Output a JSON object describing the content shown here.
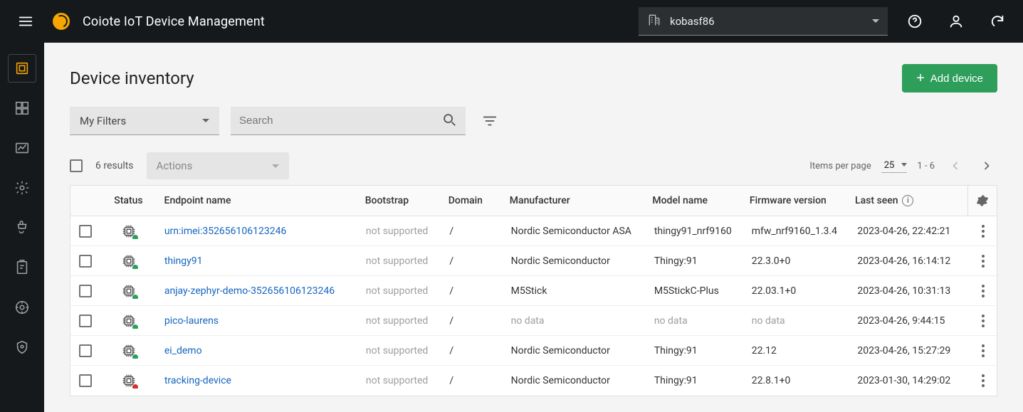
{
  "app_title": "Coiote IoT Device Management",
  "tenant_name": "kobasf86",
  "page_title": "Device inventory",
  "add_button": "Add device",
  "filters_dropdown": "My Filters",
  "search_placeholder": "Search",
  "results_label": "6 results",
  "actions_label": "Actions",
  "items_per_page_label": "Items per page",
  "items_per_page_value": "25",
  "page_range": "1 - 6",
  "columns": {
    "status": "Status",
    "endpoint": "Endpoint name",
    "bootstrap": "Bootstrap",
    "domain": "Domain",
    "manufacturer": "Manufacturer",
    "model": "Model name",
    "firmware": "Firmware version",
    "last_seen": "Last seen"
  },
  "rows": [
    {
      "status": "online",
      "endpoint": "urn:imei:352656106123246",
      "bootstrap": "not supported",
      "domain": "/",
      "manufacturer": "Nordic Semiconductor ASA",
      "model": "thingy91_nrf9160",
      "firmware": "mfw_nrf9160_1.3.4",
      "last_seen": "2023-04-26, 22:42:21"
    },
    {
      "status": "online",
      "endpoint": "thingy91",
      "bootstrap": "not supported",
      "domain": "/",
      "manufacturer": "Nordic Semiconductor",
      "model": "Thingy:91",
      "firmware": "22.3.0+0",
      "last_seen": "2023-04-26, 16:14:12"
    },
    {
      "status": "online",
      "endpoint": "anjay-zephyr-demo-352656106123246",
      "bootstrap": "not supported",
      "domain": "/",
      "manufacturer": "M5Stick",
      "model": "M5StickC-Plus",
      "firmware": "22.03.1+0",
      "last_seen": "2023-04-26, 10:31:13"
    },
    {
      "status": "online",
      "endpoint": "pico-laurens",
      "bootstrap": "not supported",
      "domain": "/",
      "manufacturer": "no data",
      "manufacturer_muted": true,
      "model": "no data",
      "model_muted": true,
      "firmware": "no data",
      "firmware_muted": true,
      "last_seen": "2023-04-26, 9:44:15"
    },
    {
      "status": "online",
      "endpoint": "ei_demo",
      "bootstrap": "not supported",
      "domain": "/",
      "manufacturer": "Nordic Semiconductor",
      "model": "Thingy:91",
      "firmware": "22.12",
      "last_seen": "2023-04-26, 15:27:29"
    },
    {
      "status": "offline",
      "endpoint": "tracking-device",
      "bootstrap": "not supported",
      "domain": "/",
      "manufacturer": "Nordic Semiconductor",
      "model": "Thingy:91",
      "firmware": "22.8.1+0",
      "last_seen": "2023-01-30, 14:29:02"
    }
  ]
}
